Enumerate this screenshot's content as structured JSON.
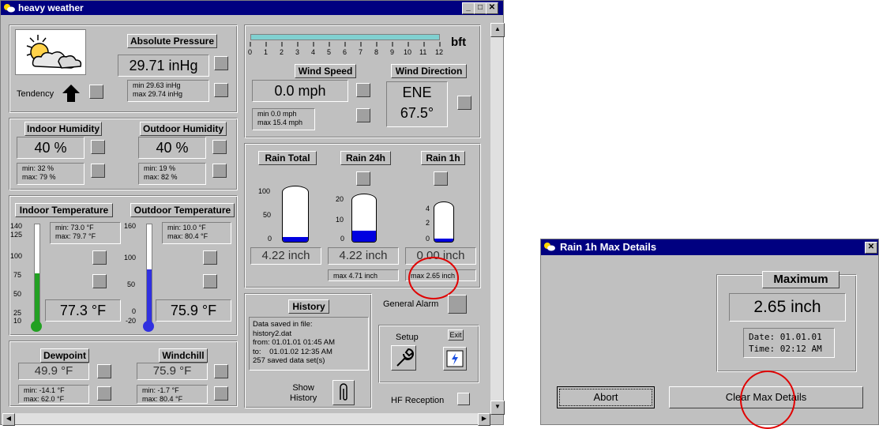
{
  "main_window": {
    "title": "heavy weather",
    "pressure": {
      "header": "Absolute Pressure",
      "value": "29.71 inHg",
      "min": "min 29.63 inHg",
      "max": "max 29.74 inHg",
      "tendency_label": "Tendency"
    },
    "wind": {
      "unit": "bft",
      "scale": [
        "0",
        "1",
        "2",
        "3",
        "4",
        "5",
        "6",
        "7",
        "8",
        "9",
        "10",
        "11",
        "12"
      ],
      "speed_header": "Wind Speed",
      "speed_value": "0.0 mph",
      "speed_min": "min 0.0 mph",
      "speed_max": "max 15.4 mph",
      "direction_header": "Wind Direction",
      "direction_value": "ENE",
      "direction_degrees": "67.5°"
    },
    "humidity": {
      "indoor_header": "Indoor Humidity",
      "indoor_value": "40 %",
      "indoor_min": "min: 32 %",
      "indoor_max": "max: 79 %",
      "outdoor_header": "Outdoor Humidity",
      "outdoor_value": "40 %",
      "outdoor_min": "min: 19 %",
      "outdoor_max": "max: 82 %"
    },
    "temperature": {
      "indoor_header": "Indoor Temperature",
      "indoor_value": "77.3 °F",
      "indoor_min": "min: 73.0 °F",
      "indoor_max": "max: 79.7 °F",
      "indoor_ticks": [
        "140",
        "125",
        "100",
        "75",
        "50",
        "25",
        "10"
      ],
      "outdoor_header": "Outdoor Temperature",
      "outdoor_value": "75.9 °F",
      "outdoor_min": "min: 10.0 °F",
      "outdoor_max": "max: 80.4 °F",
      "outdoor_ticks": [
        "160",
        "100",
        "50",
        "0",
        "-20"
      ]
    },
    "dewpoint": {
      "header": "Dewpoint",
      "value": "49.9 °F",
      "min": "min: -14.1 °F",
      "max": "max: 62.0 °F"
    },
    "windchill": {
      "header": "Windchill",
      "value": "75.9 °F",
      "min": "min: -1.7 °F",
      "max": "max: 80.4 °F"
    },
    "rain": {
      "total_header": "Rain Total",
      "h24_header": "Rain 24h",
      "h1_header": "Rain 1h",
      "total_value": "4.22 inch",
      "h24_value": "4.22 inch",
      "h1_value": "0.00 inch",
      "h24_max": "max 4.71 inch",
      "h1_max": "max 2.65 inch",
      "total_ticks": [
        "100",
        "50",
        "0"
      ],
      "h24_ticks": [
        "20",
        "10",
        "0"
      ],
      "h1_ticks": [
        "4",
        "2",
        "0"
      ]
    },
    "history": {
      "header": "History",
      "line1": "Data saved in file:",
      "line2": "history2.dat",
      "line3": "from: 01.01.01 01:45 AM",
      "line4": "to:    01.01.02 12:35 AM",
      "line5": "257 saved data set(s)",
      "show_label_1": "Show",
      "show_label_2": "History"
    },
    "general_alarm": "General Alarm",
    "setup_label": "Setup",
    "exit_label": "Exit",
    "hf_reception": "HF Reception"
  },
  "dialog": {
    "title": "Rain 1h Max Details",
    "header": "Maximum",
    "value": "2.65 inch",
    "date": "Date: 01.01.01",
    "time": "Time: 02:12 AM",
    "abort_label": "Abort",
    "clear_label": "Clear Max Details"
  }
}
